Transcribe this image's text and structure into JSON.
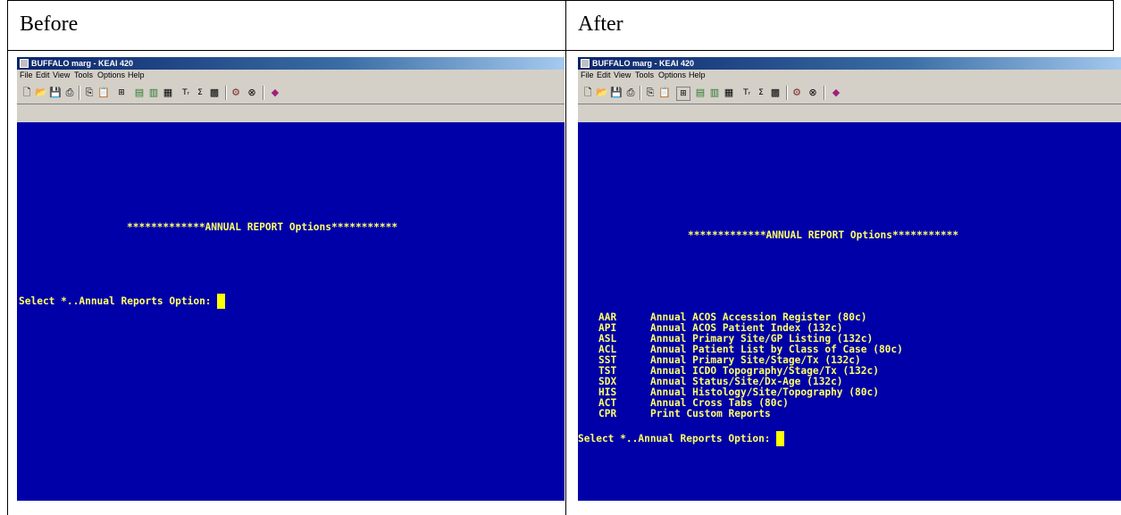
{
  "headers": {
    "before": "Before",
    "after": "After"
  },
  "window": {
    "title": "BUFFALO marg - KEAI 420",
    "menu": [
      "File",
      "Edit",
      "View",
      "Tools",
      "Options",
      "Help"
    ],
    "toolbar_icons": [
      "new-file-icon",
      "open-folder-icon",
      "save-icon",
      "print-icon",
      "copy-icon",
      "paste-icon",
      "hotspot-icon",
      "send-icon",
      "receive-icon",
      "transfer-icon",
      "font-icon",
      "color-icon",
      "settings-icon",
      "macro-icon",
      "stop-icon",
      "help-book-icon"
    ]
  },
  "before_screen": {
    "heading": "*************ANNUAL REPORT Options***********",
    "prompt": "Select *..Annual Reports Option: "
  },
  "after_screen": {
    "heading": "*************ANNUAL REPORT Options***********",
    "options": [
      {
        "code": "AAR",
        "desc": "Annual ACOS Accession Register (80c)"
      },
      {
        "code": "API",
        "desc": "Annual ACOS Patient Index (132c)"
      },
      {
        "code": "ASL",
        "desc": "Annual Primary Site/GP Listing (132c)"
      },
      {
        "code": "ACL",
        "desc": "Annual Patient List by Class of Case (80c)"
      },
      {
        "code": "SST",
        "desc": "Annual Primary Site/Stage/Tx (132c)"
      },
      {
        "code": "TST",
        "desc": "Annual ICDO Topography/Stage/Tx (132c)"
      },
      {
        "code": "SDX",
        "desc": "Annual Status/Site/Dx-Age (132c)"
      },
      {
        "code": "HIS",
        "desc": "Annual Histology/Site/Topography (80c)"
      },
      {
        "code": "ACT",
        "desc": "Annual Cross Tabs (80c)"
      },
      {
        "code": "CPR",
        "desc": "Print Custom Reports"
      }
    ],
    "prompt": "Select *..Annual Reports Option: "
  }
}
